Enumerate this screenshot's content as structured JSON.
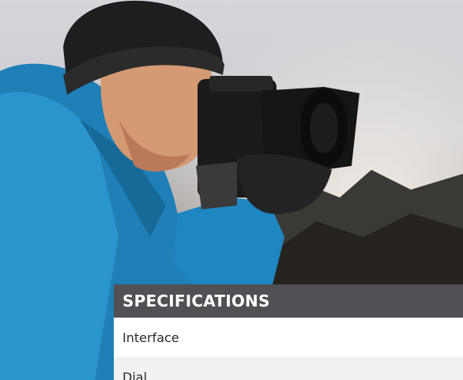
{
  "hero": {
    "image_alt": "Photographer in a blue jacket and black beanie using a camera outdoors"
  },
  "specifications": {
    "heading": "SPECIFICATIONS",
    "rows": [
      {
        "label": "Interface"
      },
      {
        "label": "Dial"
      }
    ]
  },
  "colors": {
    "header_bg": "#505055",
    "row_alt_bg": "#f1f1f3"
  }
}
